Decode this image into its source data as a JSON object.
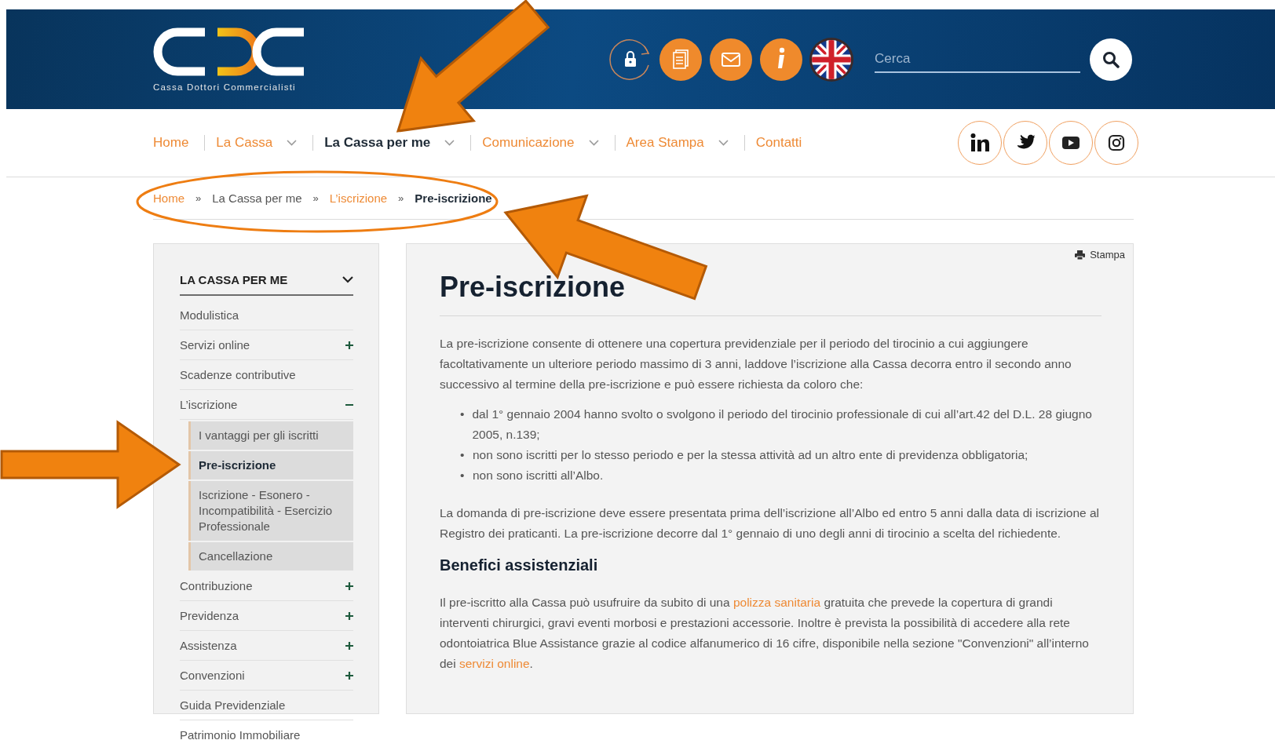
{
  "header": {
    "logo_caption": "Cassa Dottori Commercialisti",
    "search": {
      "placeholder": "Cerca"
    }
  },
  "nav": {
    "items": [
      {
        "label": "Home",
        "selected": false,
        "dropdown": false
      },
      {
        "label": "La Cassa",
        "selected": false,
        "dropdown": true
      },
      {
        "label": "La Cassa per me",
        "selected": true,
        "dropdown": true
      },
      {
        "label": "Comunicazione",
        "selected": false,
        "dropdown": true
      },
      {
        "label": "Area Stampa",
        "selected": false,
        "dropdown": true
      },
      {
        "label": "Contatti",
        "selected": false,
        "dropdown": false
      }
    ]
  },
  "breadcrumb": {
    "separators": [
      "»",
      "»",
      "»"
    ],
    "items": [
      {
        "label": "Home",
        "kind": "link"
      },
      {
        "label": "La Cassa per me",
        "kind": "plain"
      },
      {
        "label": "L’iscrizione",
        "kind": "link"
      },
      {
        "label": "Pre-iscrizione",
        "kind": "current"
      }
    ]
  },
  "sidebar": {
    "title": "LA CASSA PER ME",
    "items": [
      {
        "label": "Modulistica",
        "expandable": false
      },
      {
        "label": "Servizi online",
        "expandable": true,
        "expanded": false
      },
      {
        "label": "Scadenze contributive",
        "expandable": false
      },
      {
        "label": "L’iscrizione",
        "expandable": true,
        "expanded": true,
        "children": [
          {
            "label": "I vantaggi per gli iscritti",
            "selected": false
          },
          {
            "label": "Pre-iscrizione",
            "selected": true
          },
          {
            "label": "Iscrizione - Esonero - Incompatibilità - Esercizio Professionale",
            "selected": false
          },
          {
            "label": "Cancellazione",
            "selected": false
          }
        ]
      },
      {
        "label": "Contribuzione",
        "expandable": true,
        "expanded": false
      },
      {
        "label": "Previdenza",
        "expandable": true,
        "expanded": false
      },
      {
        "label": "Assistenza",
        "expandable": true,
        "expanded": false
      },
      {
        "label": "Convenzioni",
        "expandable": true,
        "expanded": false
      },
      {
        "label": "Guida Previdenziale",
        "expandable": false
      },
      {
        "label": "Patrimonio Immobiliare",
        "expandable": false
      }
    ]
  },
  "article": {
    "print_label": "Stampa",
    "title": "Pre-iscrizione",
    "blocks": [
      {
        "kind": "paragraph",
        "parts": [
          {
            "kind": "text",
            "text": "La pre-iscrizione consente di ottenere una copertura previdenziale per il periodo del tirocinio a cui aggiungere facoltativamente un ulteriore periodo massimo di 3 anni, laddove l’iscrizione alla Cassa decorra entro il secondo anno successivo al termine della pre-iscrizione e può essere richiesta da coloro che:"
          }
        ]
      },
      {
        "kind": "list",
        "items": [
          {
            "marker": "•",
            "text": "dal 1° gennaio 2004 hanno svolto o svolgono il periodo del tirocinio professionale di cui all’art.42 del D.L. 28 giugno 2005, n.139;"
          },
          {
            "marker": "•",
            "text": "non sono iscritti per lo stesso periodo e per la stessa attività ad un altro ente di previdenza obbligatoria;"
          },
          {
            "marker": "•",
            "text": "non sono iscritti all’Albo."
          }
        ]
      },
      {
        "kind": "paragraph",
        "parts": [
          {
            "kind": "text",
            "text": "La domanda di pre-iscrizione deve essere presentata prima dell’iscrizione all’Albo ed entro 5 anni dalla data di iscrizione al Registro dei praticanti. La pre-iscrizione decorre dal 1° gennaio di uno degli anni di tirocinio a scelta del richiedente."
          }
        ]
      },
      {
        "kind": "heading",
        "text": "Benefici assistenziali"
      },
      {
        "kind": "paragraph",
        "parts": [
          {
            "kind": "text",
            "text": "Il pre-iscritto alla Cassa può usufruire da subito di una "
          },
          {
            "kind": "link",
            "text": "polizza sanitaria"
          },
          {
            "kind": "text",
            "text": " gratuita che prevede la copertura di grandi interventi chirurgici, gravi eventi morbosi e prestazioni accessorie. Inoltre è prevista la possibilità di accedere alla rete odontoiatrica Blue Assistance grazie al codice alfanumerico di 16 cifre, disponibile nella sezione \"Convenzioni\" all’interno dei "
          },
          {
            "kind": "link",
            "text": "servizi online"
          },
          {
            "kind": "text",
            "text": "."
          }
        ]
      }
    ]
  },
  "annotations": [
    {
      "kind": "arrow"
    },
    {
      "kind": "ellipse"
    },
    {
      "kind": "arrow"
    },
    {
      "kind": "arrow"
    }
  ]
}
